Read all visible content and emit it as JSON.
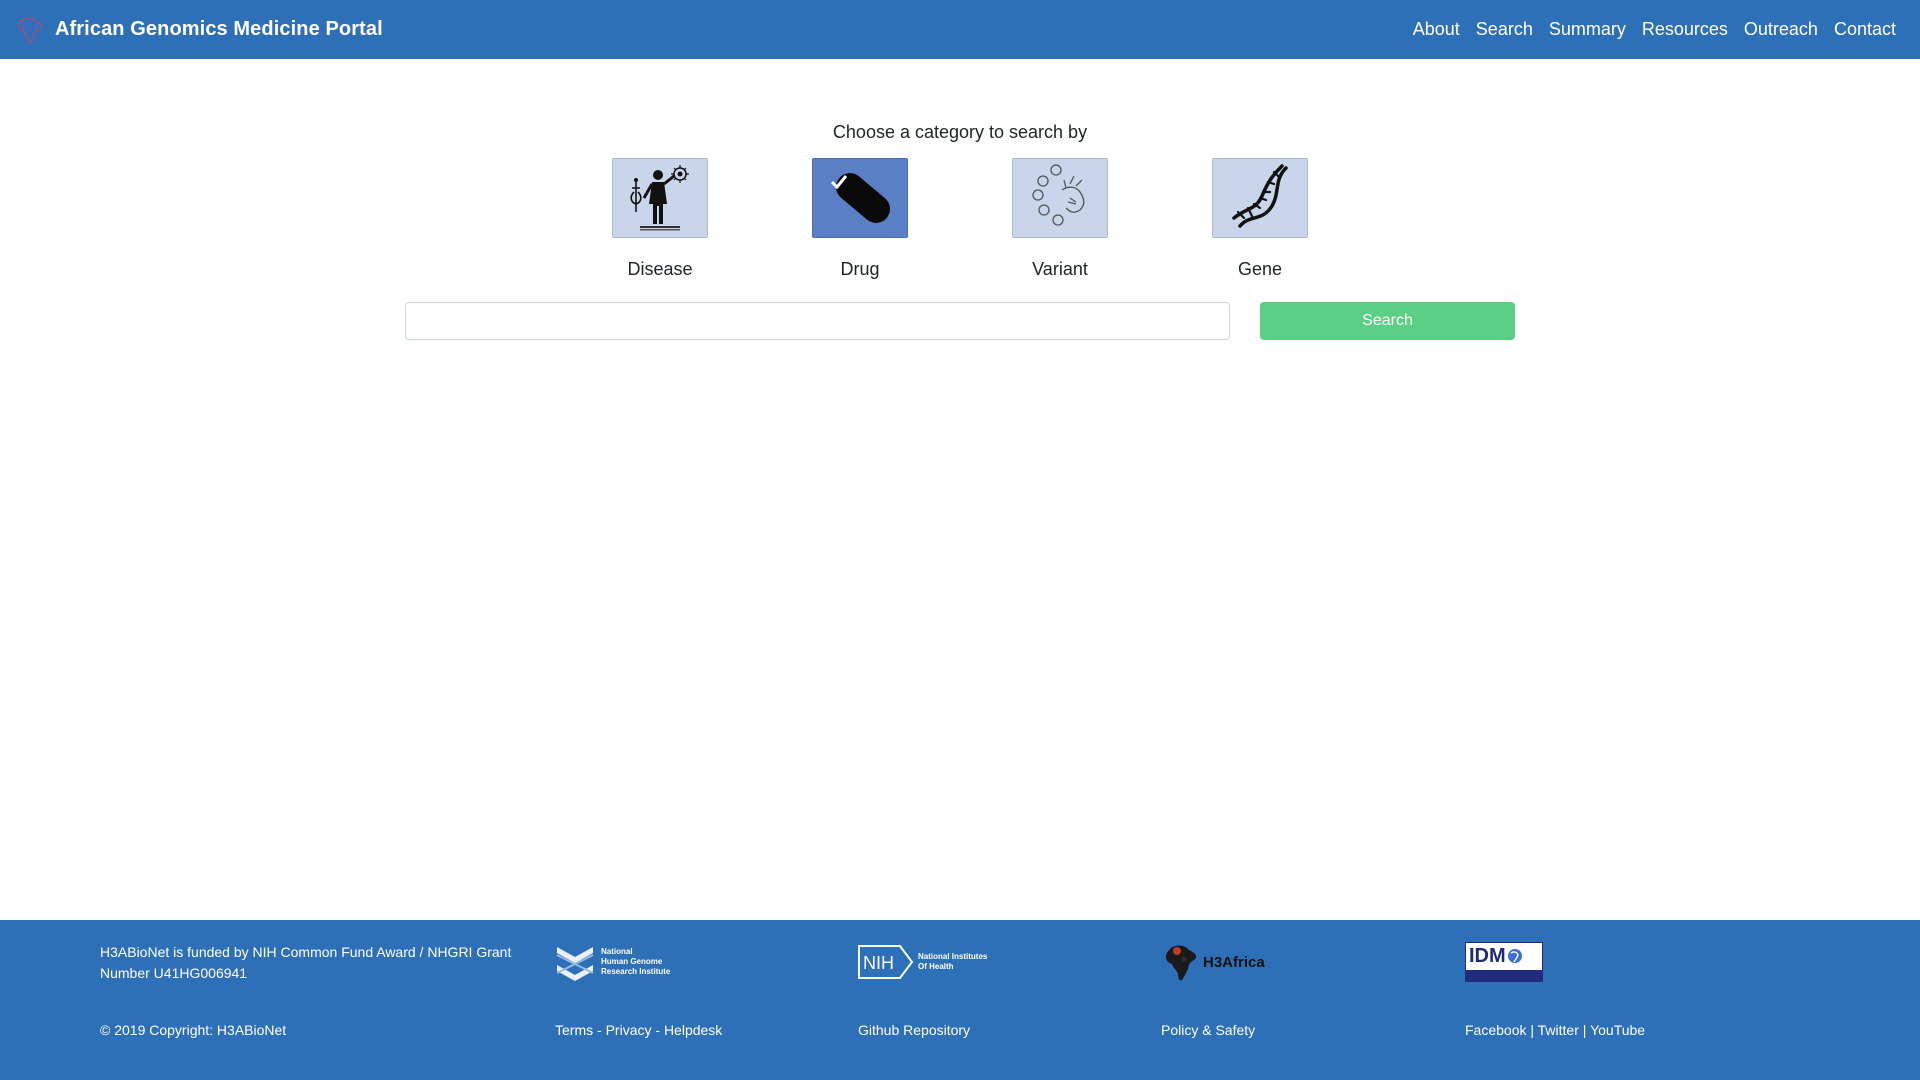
{
  "navbar": {
    "brand": "African Genomics Medicine Portal",
    "links": [
      "About",
      "Search",
      "Summary",
      "Resources",
      "Outreach",
      "Contact"
    ]
  },
  "search": {
    "heading": "Choose a category to search by",
    "categories": [
      {
        "label": "Disease",
        "icon": "doctor-icon",
        "selected": false
      },
      {
        "label": "Drug",
        "icon": "pill-icon",
        "selected": true
      },
      {
        "label": "Variant",
        "icon": "variant-icon",
        "selected": false
      },
      {
        "label": "Gene",
        "icon": "dna-icon",
        "selected": false
      }
    ],
    "input_value": "",
    "button_label": "Search"
  },
  "footer": {
    "funding": "H3ABioNet is funded by NIH Common Fund Award / NHGRI Grant Number U41HG006941",
    "copyright": "© 2019 Copyright: H3ABioNet",
    "col2": {
      "logo": "NHGRI",
      "logo_text": [
        "National",
        "Human Genome",
        "Research Institute"
      ],
      "links": [
        "Terms",
        "Privacy",
        "Helpdesk"
      ],
      "separator": " - "
    },
    "col3": {
      "logo": "NIH",
      "logo_text": [
        "National Institutes",
        "Of Health"
      ],
      "links": [
        "Github Repository"
      ]
    },
    "col4": {
      "logo": "H3Africa",
      "links": [
        "Policy & Safety"
      ]
    },
    "col5": {
      "logo": "IDM",
      "links": [
        "Facebook",
        "Twitter",
        "YouTube"
      ],
      "separator": " | "
    }
  },
  "colors": {
    "primary": "#2e70b8",
    "search_button": "#5ccf86",
    "tile_bg": "#c9d5ea",
    "tile_selected": "#5b7fc4"
  }
}
